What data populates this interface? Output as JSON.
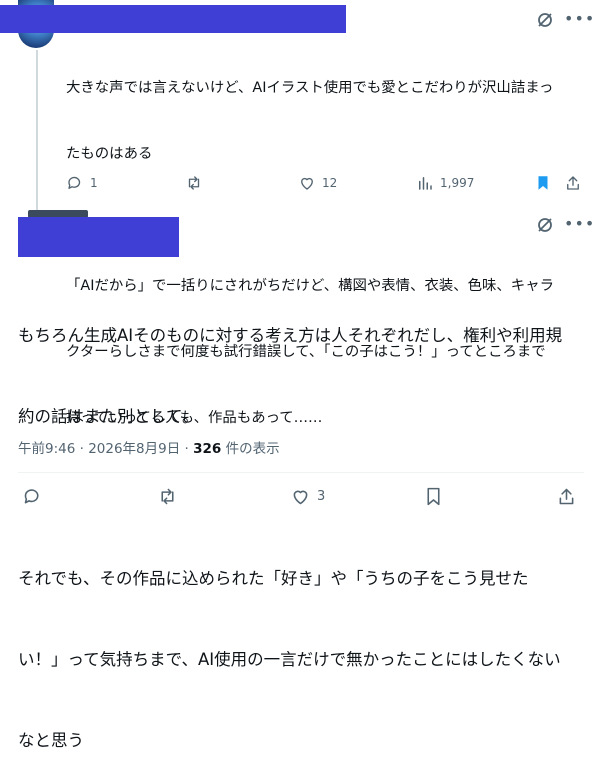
{
  "reply": {
    "text_lines": [
      "大きな声では言えないけど、AIイラスト使用でも愛とこだわりが沢山詰まっ",
      "たものはある",
      "",
      "「AIだから」で一括りにされがちだけど、構図や表情、衣装、色味、キャラ",
      "クターらしさまで何度も試行錯誤して、「この子はこう！」ってところまで",
      "持っていってる人も、作品もあって……"
    ],
    "replies_count": "1",
    "likes_count": "12",
    "views_count": "1,997"
  },
  "main_post": {
    "text_lines": [
      "もちろん生成AIそのものに対する考え方は人それぞれだし、権利や利用規",
      "約の話はまた別として。",
      "",
      "それでも、その作品に込められた「好き」や「うちの子をこう見せた",
      "い！」って気持ちまで、AI使用の一言だけで無かったことにはしたくない",
      "なと思う"
    ],
    "timestamp": "午前9:46 · 2026年8月9日 · ",
    "views_count": "326",
    "views_label": " 件の表示",
    "likes_count": "3"
  },
  "icons": {
    "grok": "grok-icon",
    "more": "more-icon",
    "reply": "reply-icon",
    "repost": "repost-icon",
    "like": "like-icon",
    "views": "views-icon",
    "bookmark": "bookmark-icon",
    "share": "share-icon"
  },
  "colors": {
    "accent": "#1d9bf0",
    "muted": "#536471",
    "redaction": "#3f3fd6"
  }
}
